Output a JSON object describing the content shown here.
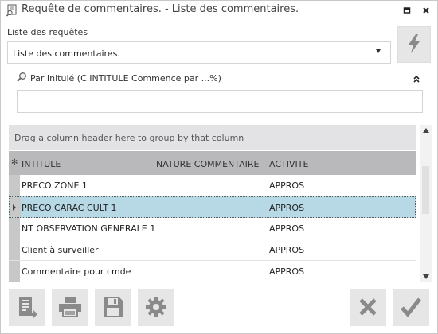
{
  "window": {
    "title": "Requête de commentaires. - Liste des commentaires.",
    "icons": [
      "doc-search-icon",
      "maximize-icon",
      "close-icon"
    ]
  },
  "requests": {
    "label": "Liste des requêtes",
    "selected": "Liste des commentaires.",
    "execute_icon": "lightning-icon"
  },
  "filter": {
    "label": "Par Initulé (C.INTITULE Commence par ...%)",
    "value": "",
    "icon": "search-icon",
    "collapse_icon": "double-chevron-up-icon"
  },
  "grid": {
    "group_panel_text": "Drag a column header here to group by that column",
    "columns": [
      "INTITULE",
      "NATURE COMMENTAIRE",
      "ACTIVITE"
    ],
    "rows": [
      {
        "intitule": "PRECO ZONE 1",
        "nature": "",
        "activite": "APPROS",
        "selected": false
      },
      {
        "intitule": "PRECO CARAC CULT 1",
        "nature": "",
        "activite": "APPROS",
        "selected": true
      },
      {
        "intitule": "NT OBSERVATION GENERALE 1",
        "nature": "",
        "activite": "APPROS",
        "selected": false
      },
      {
        "intitule": "Client à surveiller",
        "nature": "",
        "activite": "APPROS",
        "selected": false
      },
      {
        "intitule": "Commentaire pour cmde",
        "nature": "",
        "activite": "APPROS",
        "selected": false
      }
    ]
  },
  "toolbar": {
    "left_icons": [
      "export-document-icon",
      "printer-icon",
      "save-icon",
      "settings-icon"
    ],
    "right_icons": [
      "cancel-x-icon",
      "confirm-check-icon"
    ]
  },
  "colors": {
    "selected_row": "#b7d9e6",
    "header": "#b9b9bb",
    "group_panel": "#e3e3e6",
    "button_bg": "#e6e6e6",
    "icon_gray": "#8a8a8a"
  }
}
